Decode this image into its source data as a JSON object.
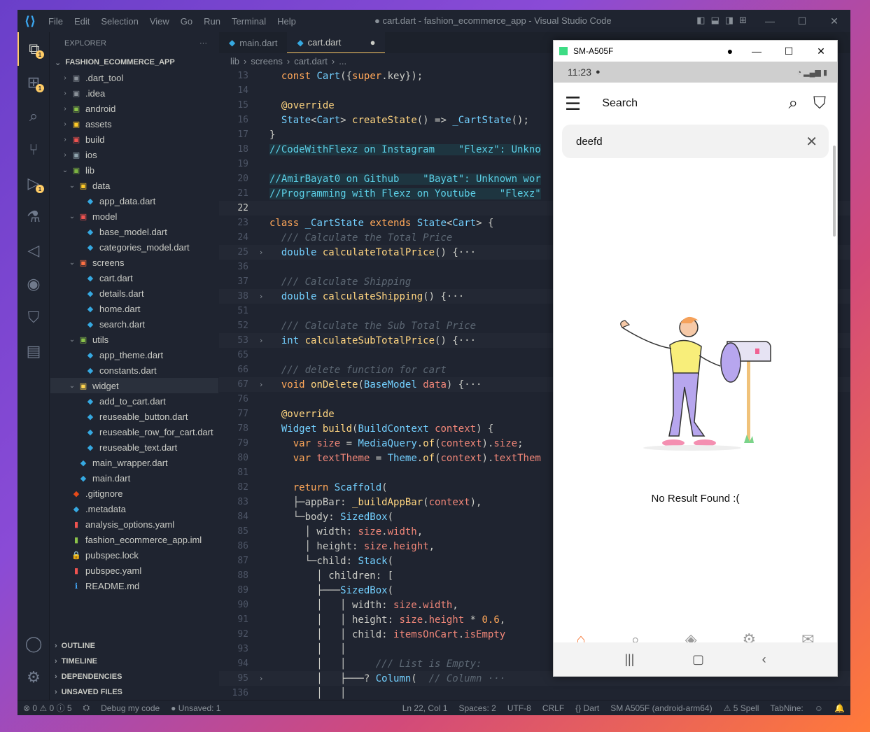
{
  "window": {
    "menu": [
      "File",
      "Edit",
      "Selection",
      "View",
      "Go",
      "Run",
      "Terminal",
      "Help"
    ],
    "title": "● cart.dart - fashion_ecommerce_app - Visual Studio Code"
  },
  "activity": {
    "explorer_badge": "1",
    "scm_badge": "1",
    "debug_badge": "1"
  },
  "sidebar": {
    "header": "EXPLORER",
    "more": "···",
    "project": "FASHION_ECOMMERCE_APP",
    "tree": [
      {
        "label": ".dart_tool",
        "depth": 1,
        "chev": "›",
        "icon": "▣",
        "color": "#8a9199"
      },
      {
        "label": ".idea",
        "depth": 1,
        "chev": "›",
        "icon": "▣",
        "color": "#8a9199"
      },
      {
        "label": "android",
        "depth": 1,
        "chev": "›",
        "icon": "▣",
        "color": "#8bc34a"
      },
      {
        "label": "assets",
        "depth": 1,
        "chev": "›",
        "icon": "▣",
        "color": "#ffca28"
      },
      {
        "label": "build",
        "depth": 1,
        "chev": "›",
        "icon": "▣",
        "color": "#ef5350"
      },
      {
        "label": "ios",
        "depth": 1,
        "chev": "›",
        "icon": "▣",
        "color": "#90a4ae"
      },
      {
        "label": "lib",
        "depth": 1,
        "chev": "⌄",
        "icon": "▣",
        "color": "#7cb342"
      },
      {
        "label": "data",
        "depth": 2,
        "chev": "⌄",
        "icon": "▣",
        "color": "#ffca28"
      },
      {
        "label": "app_data.dart",
        "depth": 3,
        "chev": "",
        "icon": "◆",
        "color": "#36a9e1"
      },
      {
        "label": "model",
        "depth": 2,
        "chev": "⌄",
        "icon": "▣",
        "color": "#ef5350"
      },
      {
        "label": "base_model.dart",
        "depth": 3,
        "chev": "",
        "icon": "◆",
        "color": "#36a9e1"
      },
      {
        "label": "categories_model.dart",
        "depth": 3,
        "chev": "",
        "icon": "◆",
        "color": "#36a9e1"
      },
      {
        "label": "screens",
        "depth": 2,
        "chev": "⌄",
        "icon": "▣",
        "color": "#ff7043"
      },
      {
        "label": "cart.dart",
        "depth": 3,
        "chev": "",
        "icon": "◆",
        "color": "#36a9e1"
      },
      {
        "label": "details.dart",
        "depth": 3,
        "chev": "",
        "icon": "◆",
        "color": "#36a9e1"
      },
      {
        "label": "home.dart",
        "depth": 3,
        "chev": "",
        "icon": "◆",
        "color": "#36a9e1"
      },
      {
        "label": "search.dart",
        "depth": 3,
        "chev": "",
        "icon": "◆",
        "color": "#36a9e1"
      },
      {
        "label": "utils",
        "depth": 2,
        "chev": "⌄",
        "icon": "▣",
        "color": "#8bc34a"
      },
      {
        "label": "app_theme.dart",
        "depth": 3,
        "chev": "",
        "icon": "◆",
        "color": "#36a9e1"
      },
      {
        "label": "constants.dart",
        "depth": 3,
        "chev": "",
        "icon": "◆",
        "color": "#36a9e1"
      },
      {
        "label": "widget",
        "depth": 2,
        "chev": "⌄",
        "icon": "▣",
        "color": "#ffd54f",
        "selected": true
      },
      {
        "label": "add_to_cart.dart",
        "depth": 3,
        "chev": "",
        "icon": "◆",
        "color": "#36a9e1"
      },
      {
        "label": "reuseable_button.dart",
        "depth": 3,
        "chev": "",
        "icon": "◆",
        "color": "#36a9e1"
      },
      {
        "label": "reuseable_row_for_cart.dart",
        "depth": 3,
        "chev": "",
        "icon": "◆",
        "color": "#36a9e1"
      },
      {
        "label": "reuseable_text.dart",
        "depth": 3,
        "chev": "",
        "icon": "◆",
        "color": "#36a9e1"
      },
      {
        "label": "main_wrapper.dart",
        "depth": 2,
        "chev": "",
        "icon": "◆",
        "color": "#36a9e1"
      },
      {
        "label": "main.dart",
        "depth": 2,
        "chev": "",
        "icon": "◆",
        "color": "#36a9e1"
      },
      {
        "label": ".gitignore",
        "depth": 1,
        "chev": "",
        "icon": "◆",
        "color": "#e64a19"
      },
      {
        "label": ".metadata",
        "depth": 1,
        "chev": "",
        "icon": "◆",
        "color": "#36a9e1"
      },
      {
        "label": "analysis_options.yaml",
        "depth": 1,
        "chev": "",
        "icon": "▮",
        "color": "#ef5350"
      },
      {
        "label": "fashion_ecommerce_app.iml",
        "depth": 1,
        "chev": "",
        "icon": "▮",
        "color": "#8bc34a"
      },
      {
        "label": "pubspec.lock",
        "depth": 1,
        "chev": "",
        "icon": "🔒",
        "color": "#ffca28"
      },
      {
        "label": "pubspec.yaml",
        "depth": 1,
        "chev": "",
        "icon": "▮",
        "color": "#ef5350"
      },
      {
        "label": "README.md",
        "depth": 1,
        "chev": "",
        "icon": "ℹ",
        "color": "#42a5f5"
      }
    ],
    "sections": [
      "OUTLINE",
      "TIMELINE",
      "DEPENDENCIES",
      "UNSAVED FILES"
    ]
  },
  "editor": {
    "tabs": [
      {
        "label": "main.dart",
        "active": false
      },
      {
        "label": "cart.dart",
        "active": true,
        "dirty": "●"
      }
    ],
    "breadcrumb": [
      "lib",
      "›",
      "screens",
      "›",
      "cart.dart",
      "›",
      "..."
    ],
    "lines": [
      {
        "n": "13",
        "html": "  <span class='kw'>const</span> <span class='ty'>Cart</span>({<span class='kw'>super</span>.key});"
      },
      {
        "n": "14",
        "html": ""
      },
      {
        "n": "15",
        "html": "  <span class='fn'>@override</span>"
      },
      {
        "n": "16",
        "html": "  <span class='ty'>State</span>&lt;<span class='ty'>Cart</span>&gt; <span class='fn'>createState</span>() =&gt; <span class='ty'>_CartState</span>();"
      },
      {
        "n": "17",
        "html": "}"
      },
      {
        "n": "18",
        "html": "//CodeWithFlexz on Instagram    \"Flexz\": Unkno",
        "cls": "blue"
      },
      {
        "n": "19",
        "html": ""
      },
      {
        "n": "20",
        "html": "//AmirBayat0 on Github    \"Bayat\": Unknown wor",
        "cls": "blue"
      },
      {
        "n": "21",
        "html": "//Programming with Flexz on Youtube    \"Flexz\"",
        "cls": "blue"
      },
      {
        "n": "22",
        "html": "",
        "cls": "cur hl"
      },
      {
        "n": "23",
        "html": "<span class='kw'>class</span> <span class='ty'>_CartState</span> <span class='kw'>extends</span> <span class='ty'>State</span>&lt;<span class='ty'>Cart</span>&gt; {"
      },
      {
        "n": "24",
        "html": "  <span class='cm'>/// Calculate the Total Price</span>"
      },
      {
        "n": "25",
        "html": "  <span class='ty'>double</span> <span class='fn'>calculateTotalPrice</span>() {···",
        "fold": "›",
        "cls": "hl"
      },
      {
        "n": "36",
        "html": ""
      },
      {
        "n": "37",
        "html": "  <span class='cm'>/// Calculate Shipping</span>"
      },
      {
        "n": "38",
        "html": "  <span class='ty'>double</span> <span class='fn'>calculateShipping</span>() {···",
        "fold": "›",
        "cls": "hl"
      },
      {
        "n": "51",
        "html": ""
      },
      {
        "n": "52",
        "html": "  <span class='cm'>/// Calculate the Sub Total Price</span>"
      },
      {
        "n": "53",
        "html": "  <span class='ty'>int</span> <span class='fn'>calculateSubTotalPrice</span>() {···",
        "fold": "›",
        "cls": "hl"
      },
      {
        "n": "65",
        "html": ""
      },
      {
        "n": "66",
        "html": "  <span class='cm'>/// delete function for cart</span>"
      },
      {
        "n": "67",
        "html": "  <span class='kw'>void</span> <span class='fn'>onDelete</span>(<span class='ty'>BaseModel</span> <span class='pr'>data</span>) {···",
        "fold": "›",
        "cls": "hl"
      },
      {
        "n": "76",
        "html": ""
      },
      {
        "n": "77",
        "html": "  <span class='fn'>@override</span>"
      },
      {
        "n": "78",
        "html": "  <span class='ty'>Widget</span> <span class='fn'>build</span>(<span class='ty'>BuildContext</span> <span class='pr'>context</span>) {"
      },
      {
        "n": "79",
        "html": "    <span class='kw'>var</span> <span class='pr'>size</span> = <span class='ty'>MediaQuery</span>.<span class='fn'>of</span>(<span class='pr'>context</span>).<span class='pr'>size</span>;"
      },
      {
        "n": "80",
        "html": "    <span class='kw'>var</span> <span class='pr'>textTheme</span> = <span class='ty'>Theme</span>.<span class='fn'>of</span>(<span class='pr'>context</span>).<span class='pr'>textThem</span>"
      },
      {
        "n": "81",
        "html": ""
      },
      {
        "n": "82",
        "html": "    <span class='kw'>return</span> <span class='ty'>Scaffold</span>("
      },
      {
        "n": "83",
        "html": "    ├─appBar: <span class='fn'>_buildAppBar</span>(<span class='pr'>context</span>),"
      },
      {
        "n": "84",
        "html": "    └─body: <span class='ty'>SizedBox</span>("
      },
      {
        "n": "85",
        "html": "      │ width: <span class='pr'>size</span>.<span class='pr'>width</span>,"
      },
      {
        "n": "86",
        "html": "      │ height: <span class='pr'>size</span>.<span class='pr'>height</span>,"
      },
      {
        "n": "87",
        "html": "      └─child: <span class='ty'>Stack</span>("
      },
      {
        "n": "88",
        "html": "        │ children: ["
      },
      {
        "n": "89",
        "html": "        ├───<span class='ty'>SizedBox</span>("
      },
      {
        "n": "90",
        "html": "        │   │ width: <span class='pr'>size</span>.<span class='pr'>width</span>,"
      },
      {
        "n": "91",
        "html": "        │   │ height: <span class='pr'>size</span>.<span class='pr'>height</span> * <span class='kw'>0.6</span>,"
      },
      {
        "n": "92",
        "html": "        │   │ child: <span class='pr'>itemsOnCart</span>.<span class='pr'>isEmpty</span>"
      },
      {
        "n": "93",
        "html": "        │   │"
      },
      {
        "n": "94",
        "html": "        │   │     <span class='cm'>/// List is Empty:</span>"
      },
      {
        "n": "95",
        "html": "        │   ├───? <span class='ty'>Column</span>(  <span class='cm'>// Column ···</span>",
        "fold": "›",
        "cls": "hl"
      },
      {
        "n": "136",
        "html": "        │   │"
      }
    ]
  },
  "status": {
    "errors": "⊗ 0 ⚠ 0 ⓘ 5",
    "debug": "Debug my code",
    "unsaved": "● Unsaved: 1",
    "position": "Ln 22, Col 1",
    "spaces": "Spaces: 2",
    "encoding": "UTF-8",
    "eol": "CRLF",
    "language": "{} Dart",
    "device": "SM A505F (android-arm64)",
    "spell": "⚠ 5 Spell",
    "tabnine": "TabNine:"
  },
  "emulator": {
    "title": "SM-A505F",
    "time": "11:23",
    "appbar_title": "Search",
    "search_value": "deefd",
    "no_result": "No Result Found :("
  }
}
